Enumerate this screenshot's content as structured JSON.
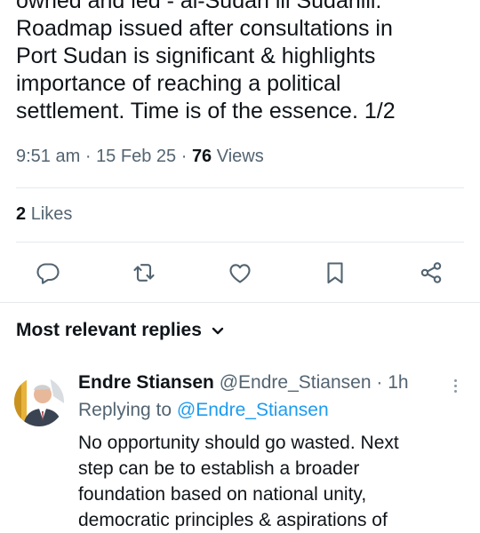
{
  "tweet": {
    "text_lines": [
      "owned and led - al-Sudan ill Sudanill.",
      "Roadmap issued after consultations in",
      "Port Sudan is significant & highlights",
      "importance of reaching a political",
      "settlement. Time is of the essence. 1/2"
    ],
    "time": "9:51 am",
    "date": "15 Feb 25",
    "separator": "·",
    "views_count": "76",
    "views_label": "Views",
    "likes_count": "2",
    "likes_label": "Likes"
  },
  "actions": [
    {
      "icon": "reply-icon"
    },
    {
      "icon": "retweet-icon"
    },
    {
      "icon": "heart-icon"
    },
    {
      "icon": "bookmark-icon"
    },
    {
      "icon": "share-icon"
    }
  ],
  "replies_section": {
    "sort_label": "Most relevant replies"
  },
  "reply": {
    "author_name": "Endre Stiansen",
    "author_handle": "@Endre_Stiansen",
    "separator": "·",
    "time_ago": "1h",
    "replying_prefix": "Replying to",
    "replying_handle": "@Endre_Stiansen",
    "text_lines": [
      "No opportunity should go wasted. Next",
      "step can be to establish a broader",
      "foundation based on national unity,",
      "democratic principles & aspirations of"
    ]
  },
  "colors": {
    "text_primary": "#0f1419",
    "text_secondary": "#536471",
    "link": "#1d9bf0",
    "divider": "#e6e9eb"
  }
}
